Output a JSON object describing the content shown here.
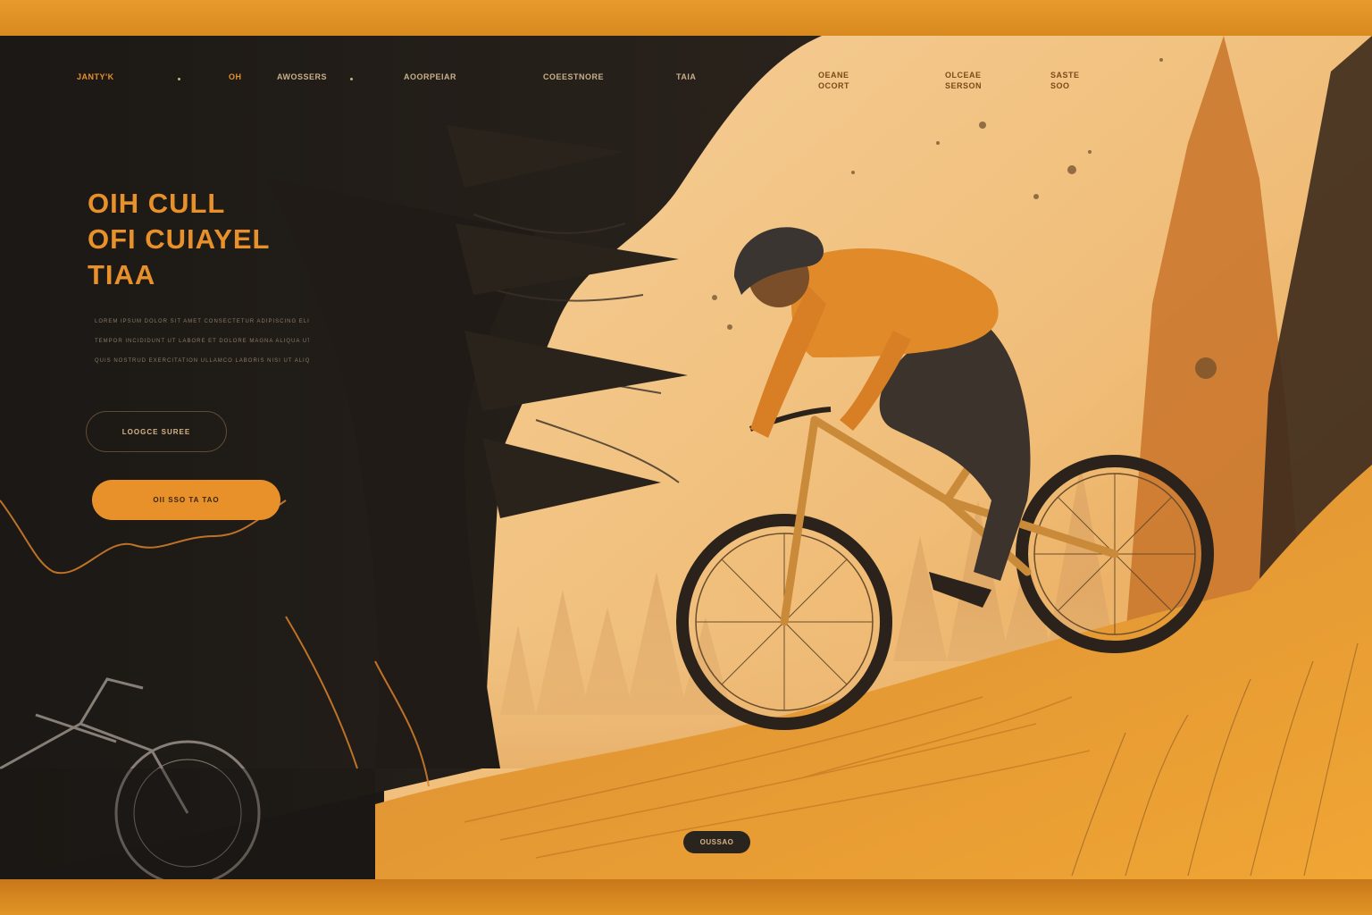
{
  "nav": {
    "brand": "JANTY'K",
    "items": [
      "OH",
      "AWOSSERS",
      "AOORPEIAR",
      "COEESTNORE",
      "TAIA"
    ],
    "right_items": [
      {
        "line1": "OEANE",
        "line2": "OCORT"
      },
      {
        "line1": "OLCEAE",
        "line2": "SERSON"
      },
      {
        "line1": "SASTE",
        "line2": "SOO"
      }
    ]
  },
  "hero": {
    "title_lines": [
      "OIH CULL",
      "OFI CUIAYEL",
      "TIAA"
    ],
    "description_lines": [
      "LOREM IPSUM DOLOR SIT AMET CONSECTETUR ADIPISCING ELIT SED DO EIUSMOD",
      "TEMPOR INCIDIDUNT UT LABORE ET DOLORE MAGNA ALIQUA UT ENIM AD MINIM VENIAM",
      "QUIS NOSTRUD EXERCITATION ULLAMCO LABORIS NISI UT ALIQUIP EX EA COMMODO"
    ],
    "secondary_button": "LOOGCE SUREE",
    "primary_button": "OII   SSO  TA  TAO"
  },
  "footer": {
    "scroll_button": "OUSSAO"
  },
  "colors": {
    "accent": "#e8912a",
    "dark": "#1b1815",
    "sky": "#f2c27f",
    "hill": "#e39a2f"
  },
  "icons": [
    "separator-dot-icon"
  ]
}
